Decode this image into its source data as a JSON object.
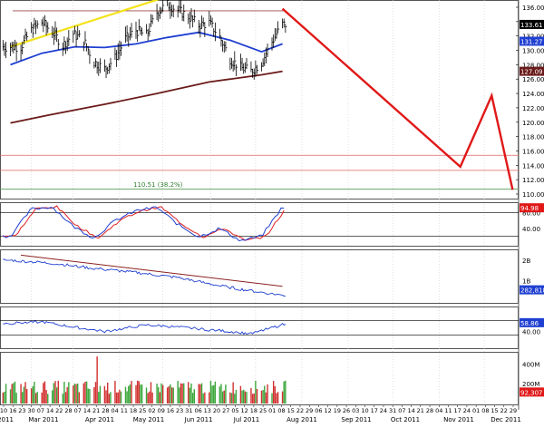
{
  "chart_data": {
    "type": "line",
    "main": {
      "y_range": [
        110,
        136
      ],
      "y_ticks": [
        "136.00",
        "134.00",
        "132.00",
        "130.00",
        "128.00",
        "126.00",
        "124.00",
        "122.00",
        "120.00",
        "118.00",
        "116.00",
        "114.00",
        "112.00",
        "110.00"
      ],
      "tag_price": "133.61",
      "tag_ma50": "131.27",
      "tag_ma200": "127.09",
      "fib_label": "110.51 (38.2%)",
      "resistance_level": 135.5,
      "support_levels": [
        115.4,
        113.3
      ],
      "fib_level": 110.51,
      "price_series": [
        [
          "2011-01-24",
          130.5
        ],
        [
          "2011-01-31",
          132.8
        ],
        [
          "2011-02-07",
          133.9
        ],
        [
          "2011-02-14",
          132.6
        ],
        [
          "2011-02-21",
          130.7
        ],
        [
          "2011-02-28",
          132.3
        ],
        [
          "2011-03-07",
          131.4
        ],
        [
          "2011-03-14",
          128.4
        ],
        [
          "2011-03-21",
          127.4
        ],
        [
          "2011-03-28",
          128.9
        ],
        [
          "2011-04-04",
          131.6
        ],
        [
          "2011-04-11",
          132.8
        ],
        [
          "2011-04-18",
          132.1
        ],
        [
          "2011-04-25",
          135.3
        ],
        [
          "2011-05-02",
          136.4
        ],
        [
          "2011-05-09",
          135.6
        ],
        [
          "2011-05-16",
          134.7
        ],
        [
          "2011-05-23",
          133.5
        ],
        [
          "2011-05-30",
          133.8
        ],
        [
          "2011-06-06",
          131.9
        ],
        [
          "2011-06-13",
          128.8
        ],
        [
          "2011-06-20",
          127.6
        ],
        [
          "2011-06-27",
          127.1
        ],
        [
          "2011-07-04",
          128.3
        ],
        [
          "2011-07-11",
          131.2
        ],
        [
          "2011-07-18",
          133.6
        ]
      ],
      "ma50_series": [
        [
          "2011-01-17",
          128.0
        ],
        [
          "2011-02-07",
          129.6
        ],
        [
          "2011-03-01",
          130.5
        ],
        [
          "2011-03-21",
          130.4
        ],
        [
          "2011-04-11",
          130.9
        ],
        [
          "2011-05-02",
          131.8
        ],
        [
          "2011-05-23",
          132.5
        ],
        [
          "2011-06-13",
          131.4
        ],
        [
          "2011-07-04",
          129.8
        ],
        [
          "2011-07-18",
          130.9
        ]
      ],
      "ma200_series": [
        [
          "2011-01-17",
          119.9
        ],
        [
          "2011-02-14",
          121.1
        ],
        [
          "2011-03-21",
          122.5
        ],
        [
          "2011-04-25",
          124.0
        ],
        [
          "2011-05-30",
          125.6
        ],
        [
          "2011-07-04",
          126.6
        ],
        [
          "2011-07-18",
          127.09
        ]
      ],
      "trendline_yellow": [
        [
          "2011-01-17",
          130.5
        ],
        [
          "2011-05-02",
          137.5
        ]
      ],
      "projection_red": [
        [
          "2011-07-18",
          135.8
        ],
        [
          "2011-11-14",
          113.8
        ],
        [
          "2011-12-05",
          123.7
        ],
        [
          "2011-12-19",
          110.6
        ]
      ]
    },
    "stochastic": {
      "y_ticks": [
        "80.00",
        "40.00"
      ],
      "levels": [
        80,
        20
      ],
      "tag": "94.98",
      "range": [
        0,
        100
      ],
      "series_k": [
        [
          "2011-01-17",
          20
        ],
        [
          "2011-01-31",
          90
        ],
        [
          "2011-02-14",
          95
        ],
        [
          "2011-02-28",
          45
        ],
        [
          "2011-03-14",
          15
        ],
        [
          "2011-03-28",
          60
        ],
        [
          "2011-04-11",
          85
        ],
        [
          "2011-04-25",
          94
        ],
        [
          "2011-05-09",
          50
        ],
        [
          "2011-05-23",
          18
        ],
        [
          "2011-06-06",
          40
        ],
        [
          "2011-06-20",
          8
        ],
        [
          "2011-07-04",
          20
        ],
        [
          "2011-07-18",
          94.98
        ]
      ]
    },
    "obv": {
      "y_ticks": [
        "2B",
        "1B"
      ],
      "tag": "282,818",
      "series": [
        [
          "2011-01-17",
          2.0
        ],
        [
          "2011-02-14",
          1.85
        ],
        [
          "2011-03-14",
          1.6
        ],
        [
          "2011-04-11",
          1.4
        ],
        [
          "2011-05-09",
          1.15
        ],
        [
          "2011-06-06",
          0.75
        ],
        [
          "2011-06-27",
          0.5
        ],
        [
          "2011-07-18",
          0.28
        ]
      ]
    },
    "rsi": {
      "y_ticks": [
        "40.00"
      ],
      "levels": [
        70,
        30
      ],
      "tag": "58.86",
      "range": [
        0,
        100
      ],
      "series": [
        [
          "2011-01-17",
          62
        ],
        [
          "2011-02-07",
          66
        ],
        [
          "2011-03-07",
          48
        ],
        [
          "2011-03-21",
          40
        ],
        [
          "2011-04-18",
          58
        ],
        [
          "2011-05-09",
          52
        ],
        [
          "2011-06-13",
          40
        ],
        [
          "2011-06-27",
          34
        ],
        [
          "2011-07-11",
          50
        ],
        [
          "2011-07-18",
          58.86
        ]
      ]
    },
    "volume": {
      "y_ticks": [
        "400M",
        "200M"
      ],
      "tag": "92,307",
      "peak_date": "2011-03-16"
    },
    "x_axis": {
      "day_labels": [
        "10",
        "16",
        "23",
        "30",
        "07",
        "14",
        "22",
        "28",
        "07",
        "14",
        "21",
        "28",
        "04",
        "11",
        "18",
        "25",
        "02",
        "09",
        "16",
        "23",
        "31",
        "06",
        "13",
        "20",
        "27",
        "05",
        "12",
        "18",
        "25",
        "01",
        "08",
        "15",
        "22",
        "29",
        "06",
        "12",
        "19",
        "26",
        "03",
        "10",
        "17",
        "24",
        "31",
        "07",
        "14",
        "21",
        "28",
        "04",
        "11",
        "17",
        "24",
        "01",
        "08",
        "15",
        "22",
        "29"
      ],
      "month_labels": [
        "2011",
        "Mar 2011",
        "Apr 2011",
        "May 2011",
        "Jun 2011",
        "Jul 2011",
        "Aug 2011",
        "Sep 2011",
        "Oct 2011",
        "Nov 2011",
        "Dec 2011"
      ]
    }
  }
}
